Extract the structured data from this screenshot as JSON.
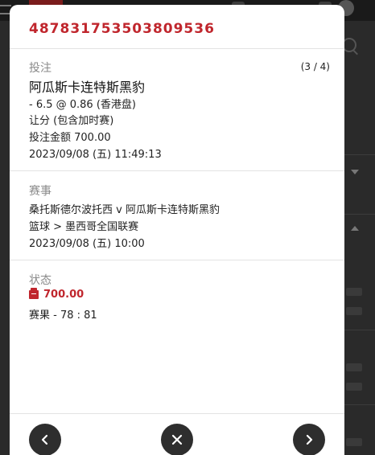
{
  "modal": {
    "bet_id": "487831753503809536",
    "counter": "(3 / 4)",
    "bet": {
      "label": "投注",
      "selection": "阿瓜斯卡连特斯黑豹",
      "odds_line": "- 6.5 @ 0.86 (香港盘)",
      "market": "让分 (包含加时赛)",
      "stake": "投注金额 700.00",
      "placed_at": "2023/09/08 (五) 11:49:13"
    },
    "event": {
      "label": "赛事",
      "match": "桑托斯德尔波托西 v 阿瓜斯卡连特斯黑豹",
      "league": "篮球 > 墨西哥全国联赛",
      "start_time": "2023/09/08 (五) 10:00"
    },
    "status": {
      "label": "状态",
      "amount": "700.00",
      "icon": "cash-register-icon",
      "result": "赛果 - 78 : 81"
    }
  },
  "footer": {
    "prev_icon": "chevron-left-icon",
    "close_icon": "close-icon",
    "next_icon": "chevron-right-icon"
  },
  "colors": {
    "accent": "#c0262d",
    "button_bg": "#2e2e2e",
    "overlay_bg": "#2a2a2a"
  }
}
